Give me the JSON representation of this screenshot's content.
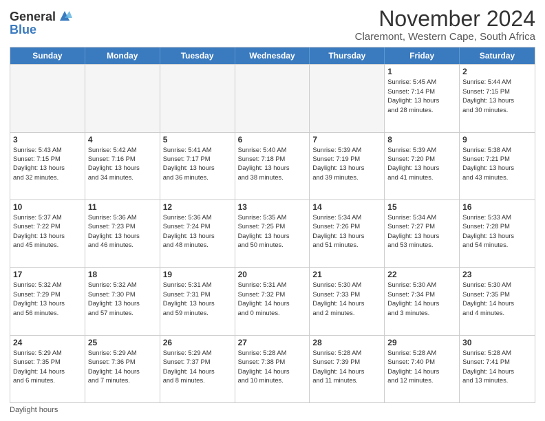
{
  "logo": {
    "general": "General",
    "blue": "Blue"
  },
  "title": "November 2024",
  "subtitle": "Claremont, Western Cape, South Africa",
  "days": [
    "Sunday",
    "Monday",
    "Tuesday",
    "Wednesday",
    "Thursday",
    "Friday",
    "Saturday"
  ],
  "footer": "Daylight hours",
  "weeks": [
    [
      {
        "day": "",
        "info": ""
      },
      {
        "day": "",
        "info": ""
      },
      {
        "day": "",
        "info": ""
      },
      {
        "day": "",
        "info": ""
      },
      {
        "day": "",
        "info": ""
      },
      {
        "day": "1",
        "info": "Sunrise: 5:45 AM\nSunset: 7:14 PM\nDaylight: 13 hours\nand 28 minutes."
      },
      {
        "day": "2",
        "info": "Sunrise: 5:44 AM\nSunset: 7:15 PM\nDaylight: 13 hours\nand 30 minutes."
      }
    ],
    [
      {
        "day": "3",
        "info": "Sunrise: 5:43 AM\nSunset: 7:15 PM\nDaylight: 13 hours\nand 32 minutes."
      },
      {
        "day": "4",
        "info": "Sunrise: 5:42 AM\nSunset: 7:16 PM\nDaylight: 13 hours\nand 34 minutes."
      },
      {
        "day": "5",
        "info": "Sunrise: 5:41 AM\nSunset: 7:17 PM\nDaylight: 13 hours\nand 36 minutes."
      },
      {
        "day": "6",
        "info": "Sunrise: 5:40 AM\nSunset: 7:18 PM\nDaylight: 13 hours\nand 38 minutes."
      },
      {
        "day": "7",
        "info": "Sunrise: 5:39 AM\nSunset: 7:19 PM\nDaylight: 13 hours\nand 39 minutes."
      },
      {
        "day": "8",
        "info": "Sunrise: 5:39 AM\nSunset: 7:20 PM\nDaylight: 13 hours\nand 41 minutes."
      },
      {
        "day": "9",
        "info": "Sunrise: 5:38 AM\nSunset: 7:21 PM\nDaylight: 13 hours\nand 43 minutes."
      }
    ],
    [
      {
        "day": "10",
        "info": "Sunrise: 5:37 AM\nSunset: 7:22 PM\nDaylight: 13 hours\nand 45 minutes."
      },
      {
        "day": "11",
        "info": "Sunrise: 5:36 AM\nSunset: 7:23 PM\nDaylight: 13 hours\nand 46 minutes."
      },
      {
        "day": "12",
        "info": "Sunrise: 5:36 AM\nSunset: 7:24 PM\nDaylight: 13 hours\nand 48 minutes."
      },
      {
        "day": "13",
        "info": "Sunrise: 5:35 AM\nSunset: 7:25 PM\nDaylight: 13 hours\nand 50 minutes."
      },
      {
        "day": "14",
        "info": "Sunrise: 5:34 AM\nSunset: 7:26 PM\nDaylight: 13 hours\nand 51 minutes."
      },
      {
        "day": "15",
        "info": "Sunrise: 5:34 AM\nSunset: 7:27 PM\nDaylight: 13 hours\nand 53 minutes."
      },
      {
        "day": "16",
        "info": "Sunrise: 5:33 AM\nSunset: 7:28 PM\nDaylight: 13 hours\nand 54 minutes."
      }
    ],
    [
      {
        "day": "17",
        "info": "Sunrise: 5:32 AM\nSunset: 7:29 PM\nDaylight: 13 hours\nand 56 minutes."
      },
      {
        "day": "18",
        "info": "Sunrise: 5:32 AM\nSunset: 7:30 PM\nDaylight: 13 hours\nand 57 minutes."
      },
      {
        "day": "19",
        "info": "Sunrise: 5:31 AM\nSunset: 7:31 PM\nDaylight: 13 hours\nand 59 minutes."
      },
      {
        "day": "20",
        "info": "Sunrise: 5:31 AM\nSunset: 7:32 PM\nDaylight: 14 hours\nand 0 minutes."
      },
      {
        "day": "21",
        "info": "Sunrise: 5:30 AM\nSunset: 7:33 PM\nDaylight: 14 hours\nand 2 minutes."
      },
      {
        "day": "22",
        "info": "Sunrise: 5:30 AM\nSunset: 7:34 PM\nDaylight: 14 hours\nand 3 minutes."
      },
      {
        "day": "23",
        "info": "Sunrise: 5:30 AM\nSunset: 7:35 PM\nDaylight: 14 hours\nand 4 minutes."
      }
    ],
    [
      {
        "day": "24",
        "info": "Sunrise: 5:29 AM\nSunset: 7:35 PM\nDaylight: 14 hours\nand 6 minutes."
      },
      {
        "day": "25",
        "info": "Sunrise: 5:29 AM\nSunset: 7:36 PM\nDaylight: 14 hours\nand 7 minutes."
      },
      {
        "day": "26",
        "info": "Sunrise: 5:29 AM\nSunset: 7:37 PM\nDaylight: 14 hours\nand 8 minutes."
      },
      {
        "day": "27",
        "info": "Sunrise: 5:28 AM\nSunset: 7:38 PM\nDaylight: 14 hours\nand 10 minutes."
      },
      {
        "day": "28",
        "info": "Sunrise: 5:28 AM\nSunset: 7:39 PM\nDaylight: 14 hours\nand 11 minutes."
      },
      {
        "day": "29",
        "info": "Sunrise: 5:28 AM\nSunset: 7:40 PM\nDaylight: 14 hours\nand 12 minutes."
      },
      {
        "day": "30",
        "info": "Sunrise: 5:28 AM\nSunset: 7:41 PM\nDaylight: 14 hours\nand 13 minutes."
      }
    ]
  ]
}
